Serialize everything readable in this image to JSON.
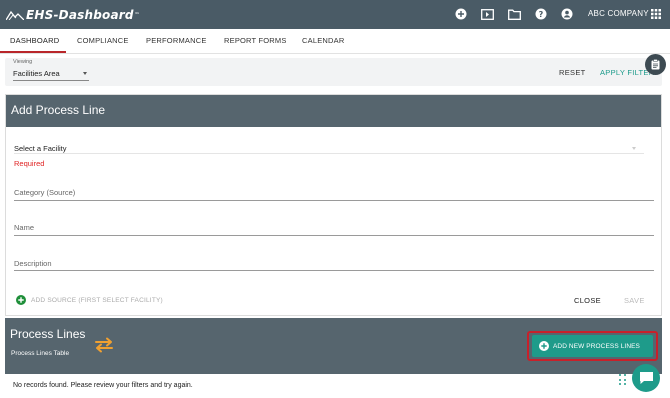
{
  "app": {
    "logo_text": "EHS-Dashboard",
    "logo_tm": "™",
    "company": "ABC COMPANY"
  },
  "topbar_icons": [
    "add-circle-icon",
    "presentation-icon",
    "folder-icon",
    "help-icon",
    "account-icon",
    "apps-grid-icon"
  ],
  "nav": {
    "tabs": [
      {
        "label": "DASHBOARD",
        "active": true
      },
      {
        "label": "COMPLIANCE"
      },
      {
        "label": "PERFORMANCE"
      },
      {
        "label": "REPORT FORMS"
      },
      {
        "label": "CALENDAR"
      }
    ]
  },
  "filter": {
    "viewing_label": "Viewing",
    "viewing_value": "Facilities Area",
    "reset_label": "RESET",
    "apply_label": "APPLY FILTER"
  },
  "form": {
    "title": "Add Process Line",
    "facility_placeholder": "Select a Facility",
    "required_text": "Required",
    "category_label": "Category (Source)",
    "name_label": "Name",
    "description_label": "Description",
    "add_source_label": "ADD SOURCE (FIRST SELECT FACILITY)",
    "close_label": "CLOSE",
    "save_label": "SAVE"
  },
  "process_lines": {
    "title": "Process Lines",
    "subtitle": "Process Lines Table",
    "add_button_label": "ADD NEW PROCESS LINES",
    "empty_message": "No records found. Please review your filters and try again."
  },
  "colors": {
    "topbar": "#4a5b66",
    "section_header": "#56656e",
    "accent_teal": "#1e9b8a",
    "active_tab_underline": "#b9262a",
    "highlight_red": "#c8202a",
    "required_red": "#e02424",
    "swap_icon_orange": "#f0a030"
  }
}
